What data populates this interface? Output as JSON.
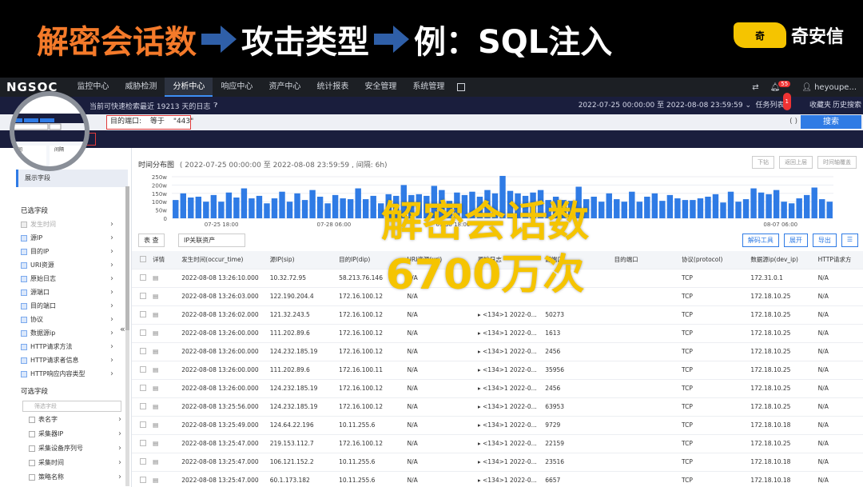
{
  "banner": {
    "part1": "解密会话数",
    "part2": "攻击类型",
    "part3": "例：SQL注入",
    "logo_mark": "奇",
    "logo_name": "奇安信",
    "orange": "#f47a2a",
    "yellow": "#f5c400",
    "arrow_color": "#2f5fa8"
  },
  "topnav": {
    "brand": "NGSOC",
    "items": [
      "监控中心",
      "威胁检测",
      "分析中心",
      "响应中心",
      "资产中心",
      "统计报表",
      "安全管理",
      "系统管理"
    ],
    "active_index": 2,
    "alert_count": "55",
    "user": "heyoupe..."
  },
  "subbar": {
    "hint": "当前可快速检索最近 19213 天的日志",
    "time_range": "2022-07-25 00:00:00 至 2022-08-08 23:59:59",
    "task_label": "任务列表",
    "task_count": "1",
    "favorite_label": "收藏夹",
    "history_label": "历史搜索"
  },
  "query": {
    "filter_field": "目的端口:",
    "filter_op": "等于",
    "filter_value": "\"443\"",
    "search_label": "搜索",
    "tools": "( )"
  },
  "left_panel": {
    "display_fields": "展示字段",
    "selected_fields_title": "已选字段",
    "selected_fields": [
      "发生时间",
      "源IP",
      "目的IP",
      "URI资源",
      "原始日志",
      "源端口",
      "目的端口",
      "协议",
      "数据源ip",
      "HTTP请求方法",
      "HTTP请求者信息",
      "HTTP响应内容类型"
    ],
    "optional_fields_title": "可选字段",
    "search_placeholder": "筛选字段",
    "optional_fields": [
      "表名字",
      "采集器IP",
      "采集设备序列号",
      "采集时间",
      "策略名称"
    ]
  },
  "histogram": {
    "title": "时间分布图",
    "range": "( 2022-07-25 00:00:00 至 2022-08-08 23:59:59 , 间隔: 6h)",
    "buttons": [
      "下钻",
      "返回上层",
      "时间轴覆盖"
    ],
    "bar_color": "#2f7be5"
  },
  "chart_data": {
    "type": "bar",
    "title": "时间分布图",
    "xlabel": "",
    "ylabel": "",
    "y_tick_labels": [
      "250w",
      "200w",
      "150w",
      "100w",
      "50w",
      "0"
    ],
    "ylim": [
      0,
      2500000
    ],
    "x_tick_labels": [
      "07-25 18:00",
      "07-28 06:00",
      "07-30 18:00",
      "08-07 06:00"
    ],
    "grid": true,
    "values": [
      1100000,
      1500000,
      1250000,
      1300000,
      1000000,
      1400000,
      1000000,
      1550000,
      1250000,
      1800000,
      1200000,
      1350000,
      900000,
      1200000,
      1600000,
      1000000,
      1500000,
      1100000,
      1700000,
      1300000,
      900000,
      1400000,
      1200000,
      1150000,
      1800000,
      1150000,
      1350000,
      900000,
      1450000,
      1350000,
      2000000,
      1400000,
      1450000,
      1350000,
      1950000,
      1700000,
      1050000,
      1550000,
      1400000,
      1600000,
      1300000,
      1700000,
      1500000,
      2550000,
      1650000,
      1500000,
      1350000,
      1550000,
      1700000,
      1100000,
      1300000,
      1100000,
      1050000,
      1900000,
      1150000,
      1300000,
      1000000,
      1500000,
      1150000,
      1000000,
      1600000,
      1000000,
      1300000,
      1500000,
      1050000,
      1400000,
      1200000,
      1100000,
      1100000,
      1200000,
      1300000,
      1450000,
      950000,
      1600000,
      1000000,
      1150000,
      1800000,
      1550000,
      1450000,
      1700000,
      1000000,
      900000,
      1200000,
      1400000,
      1850000,
      1150000,
      1000000
    ]
  },
  "overlay": {
    "line1": "解密会话数",
    "line2": "6700万次"
  },
  "table_tools": {
    "select1": "表 查",
    "select2": "IP关联资产",
    "buttons": [
      "解码工具",
      "展开",
      "导出"
    ]
  },
  "table": {
    "headers": [
      "详情",
      "发生时间(occur_time)",
      "源IP(sip)",
      "目的IP(dip)",
      "URI资源(uri)",
      "原始日志",
      "源端口",
      "目的端口",
      "协议(protocol)",
      "数据源ip(dev_ip)",
      "HTTP请求方"
    ],
    "rows": [
      [
        "2022-08-08 13:26:10.000",
        "10.32.72.95",
        "58.213.76.146",
        "N/A",
        "",
        "",
        "",
        "TCP",
        "172.31.0.1",
        "N/A"
      ],
      [
        "2022-08-08 13:26:03.000",
        "122.190.204.4",
        "172.16.100.12",
        "N/A",
        "",
        "",
        "",
        "TCP",
        "172.18.10.25",
        "N/A"
      ],
      [
        "2022-08-08 13:26:02.000",
        "121.32.243.5",
        "172.16.100.12",
        "N/A",
        "<134>1 2022-0...",
        "50273",
        "",
        "TCP",
        "172.18.10.25",
        "N/A"
      ],
      [
        "2022-08-08 13:26:00.000",
        "111.202.89.6",
        "172.16.100.12",
        "N/A",
        "<134>1 2022-0...",
        "1613",
        "",
        "TCP",
        "172.18.10.25",
        "N/A"
      ],
      [
        "2022-08-08 13:26:00.000",
        "124.232.185.19",
        "172.16.100.12",
        "N/A",
        "<134>1 2022-0...",
        "2456",
        "",
        "TCP",
        "172.18.10.25",
        "N/A"
      ],
      [
        "2022-08-08 13:26:00.000",
        "111.202.89.6",
        "172.16.100.11",
        "N/A",
        "<134>1 2022-0...",
        "35956",
        "",
        "TCP",
        "172.18.10.25",
        "N/A"
      ],
      [
        "2022-08-08 13:26:00.000",
        "124.232.185.19",
        "172.16.100.12",
        "N/A",
        "<134>1 2022-0...",
        "2456",
        "",
        "TCP",
        "172.18.10.25",
        "N/A"
      ],
      [
        "2022-08-08 13:25:56.000",
        "124.232.185.19",
        "172.16.100.12",
        "N/A",
        "<134>1 2022-0...",
        "63953",
        "",
        "TCP",
        "172.18.10.25",
        "N/A"
      ],
      [
        "2022-08-08 13:25:49.000",
        "124.64.22.196",
        "10.11.255.6",
        "N/A",
        "<134>1 2022-0...",
        "9729",
        "",
        "TCP",
        "172.18.10.18",
        "N/A"
      ],
      [
        "2022-08-08 13:25:47.000",
        "219.153.112.7",
        "172.16.100.12",
        "N/A",
        "<134>1 2022-0...",
        "22159",
        "",
        "TCP",
        "172.18.10.25",
        "N/A"
      ],
      [
        "2022-08-08 13:25:47.000",
        "106.121.152.2",
        "10.11.255.6",
        "N/A",
        "<134>1 2022-0...",
        "23516",
        "",
        "TCP",
        "172.18.10.18",
        "N/A"
      ],
      [
        "2022-08-08 13:25:47.000",
        "60.1.173.182",
        "10.11.255.6",
        "N/A",
        "<134>1 2022-0...",
        "6657",
        "",
        "TCP",
        "172.18.10.18",
        "N/A"
      ]
    ]
  },
  "magnifier": {
    "label1": "时间",
    "label2": "间隔"
  }
}
